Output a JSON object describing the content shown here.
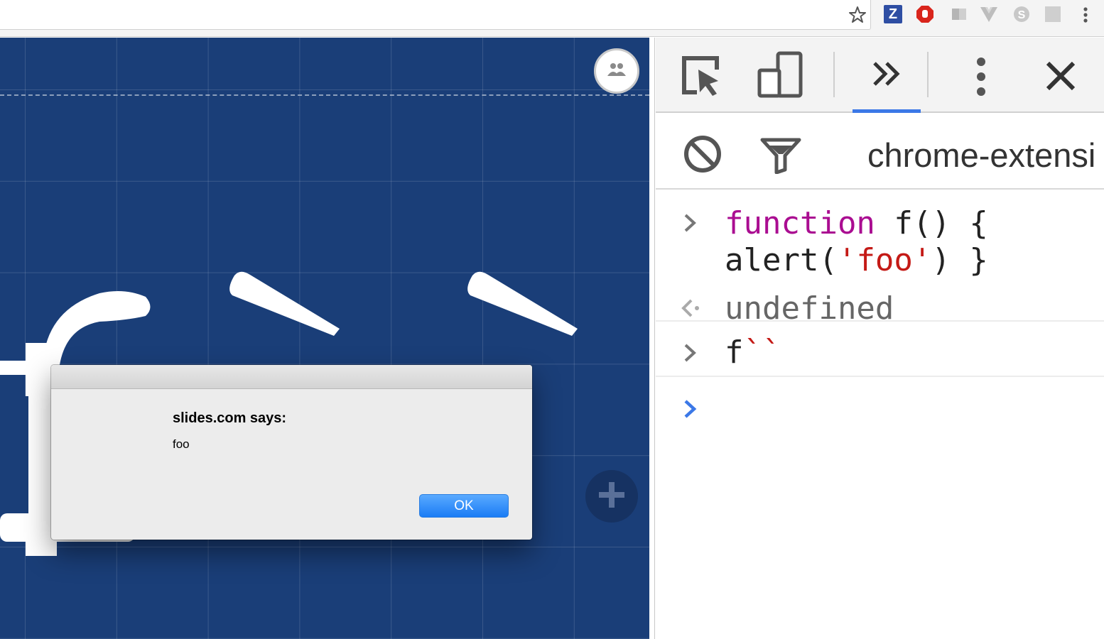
{
  "browser": {
    "toolbar_icons": [
      "star-icon",
      "extension-z-icon",
      "extension-stop-icon",
      "extension-generic-icon",
      "extension-vue-icon",
      "extension-skype-icon",
      "extension-generic-icon",
      "menu-dots-icon"
    ],
    "ext_z_label": "Z"
  },
  "editor": {
    "background_color": "#1a3e78",
    "slide_text": "f``"
  },
  "dialog": {
    "title": "slides.com says:",
    "message": "foo",
    "ok_label": "OK"
  },
  "devtools": {
    "toolbar_icons": [
      "inspect-element-icon",
      "device-toolbar-icon",
      "more-tabs-icon",
      "kebab-menu-icon",
      "close-icon"
    ],
    "console_toolbar_icons": [
      "clear-console-icon",
      "filter-icon"
    ],
    "context_label": "chrome-extensi",
    "accent_color": "#3b78e7",
    "console": {
      "entry1_keyword": "function",
      "entry1_rest": " f() {",
      "entry1_line2_start": "alert(",
      "entry1_string": "'foo'",
      "entry1_line2_end": ") }",
      "result1": "undefined",
      "entry2_name": "f",
      "entry2_template": "``"
    }
  }
}
